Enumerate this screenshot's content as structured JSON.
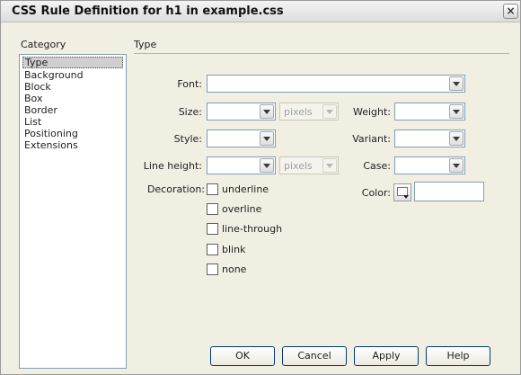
{
  "window": {
    "title": "CSS Rule Definition for h1 in example.css",
    "close_glyph": "×"
  },
  "category": {
    "heading": "Category",
    "items": [
      "Type",
      "Background",
      "Block",
      "Box",
      "Border",
      "List",
      "Positioning",
      "Extensions"
    ],
    "selected": "Type"
  },
  "panel": {
    "heading": "Type"
  },
  "fields": {
    "font": {
      "label": "Font:",
      "value": ""
    },
    "size": {
      "label": "Size:",
      "value": "",
      "unit": "pixels"
    },
    "weight": {
      "label": "Weight:",
      "value": ""
    },
    "style": {
      "label": "Style:",
      "value": ""
    },
    "variant": {
      "label": "Variant:",
      "value": ""
    },
    "line_height": {
      "label": "Line height:",
      "value": "",
      "unit": "pixels"
    },
    "case": {
      "label": "Case:",
      "value": ""
    },
    "color": {
      "label": "Color:",
      "value": ""
    },
    "decoration": {
      "label": "Decoration:",
      "options": [
        "underline",
        "overline",
        "line-through",
        "blink",
        "none"
      ]
    }
  },
  "buttons": {
    "ok": "OK",
    "cancel": "Cancel",
    "apply": "Apply",
    "help": "Help"
  }
}
